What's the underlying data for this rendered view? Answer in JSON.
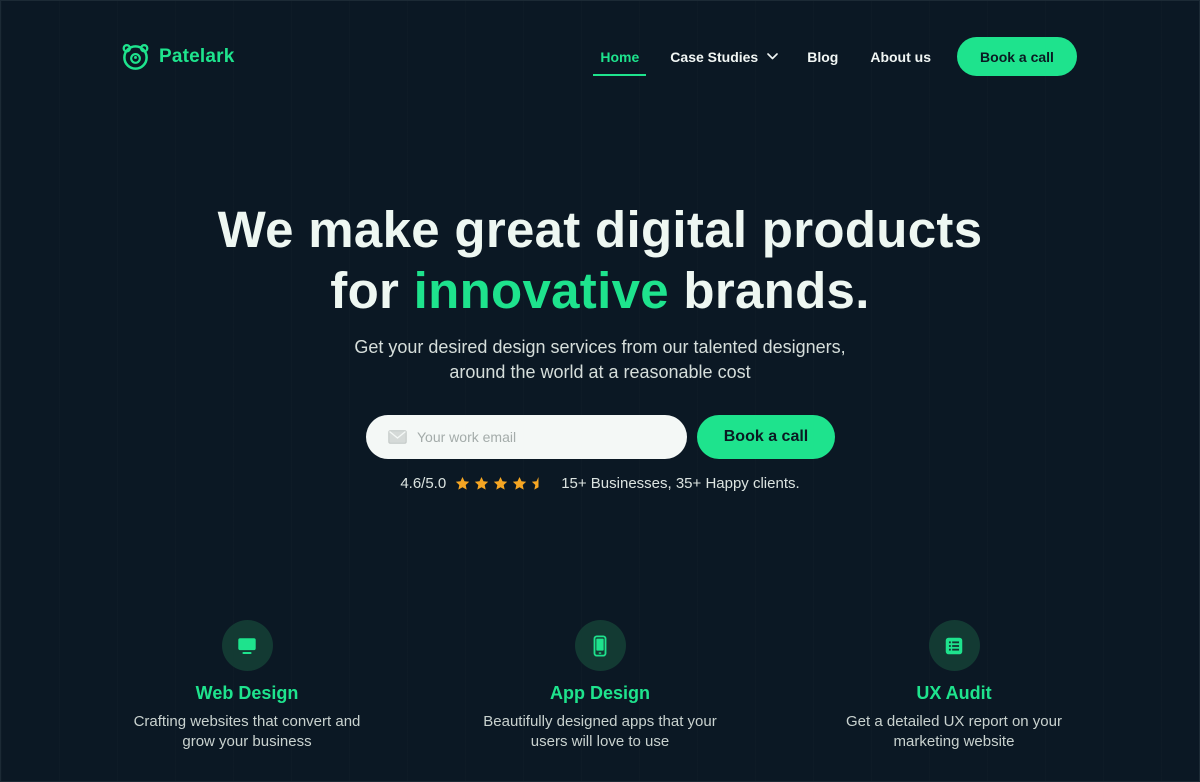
{
  "brand": {
    "name": "Patelark",
    "logo_icon": "bear-face-icon"
  },
  "nav": {
    "items": [
      {
        "label": "Home",
        "active": true
      },
      {
        "label": "Case Studies",
        "has_dropdown": true
      },
      {
        "label": "Blog"
      },
      {
        "label": "About us"
      }
    ],
    "cta_label": "Book a call"
  },
  "hero": {
    "title_line1": "We make great digital products",
    "title_line2_pre": "for ",
    "title_line2_accent": "innovative",
    "title_line2_post": " brands.",
    "subtitle_line1": "Get your desired design services from our talented designers,",
    "subtitle_line2": "around the world at a reasonable cost",
    "email_placeholder": "Your work email",
    "email_icon": "mail-icon",
    "cta_label": "Book a call",
    "rating_score": "4.6/5.0",
    "rating_value": 4.6,
    "rating_max": 5,
    "social_proof": "15+ Businesses, 35+ Happy clients."
  },
  "features": [
    {
      "icon": "monitor-icon",
      "title": "Web Design",
      "desc": "Crafting websites that convert and grow your business"
    },
    {
      "icon": "smartphone-icon",
      "title": "App Design",
      "desc": "Beautifully designed apps that your users will love to use"
    },
    {
      "icon": "report-list-icon",
      "title": "UX Audit",
      "desc": "Get a detailed UX report on your marketing website"
    }
  ],
  "colors": {
    "background": "#0b1824",
    "accent": "#1ee38d",
    "star": "#f6a623",
    "icon_circle": "#133a33"
  }
}
